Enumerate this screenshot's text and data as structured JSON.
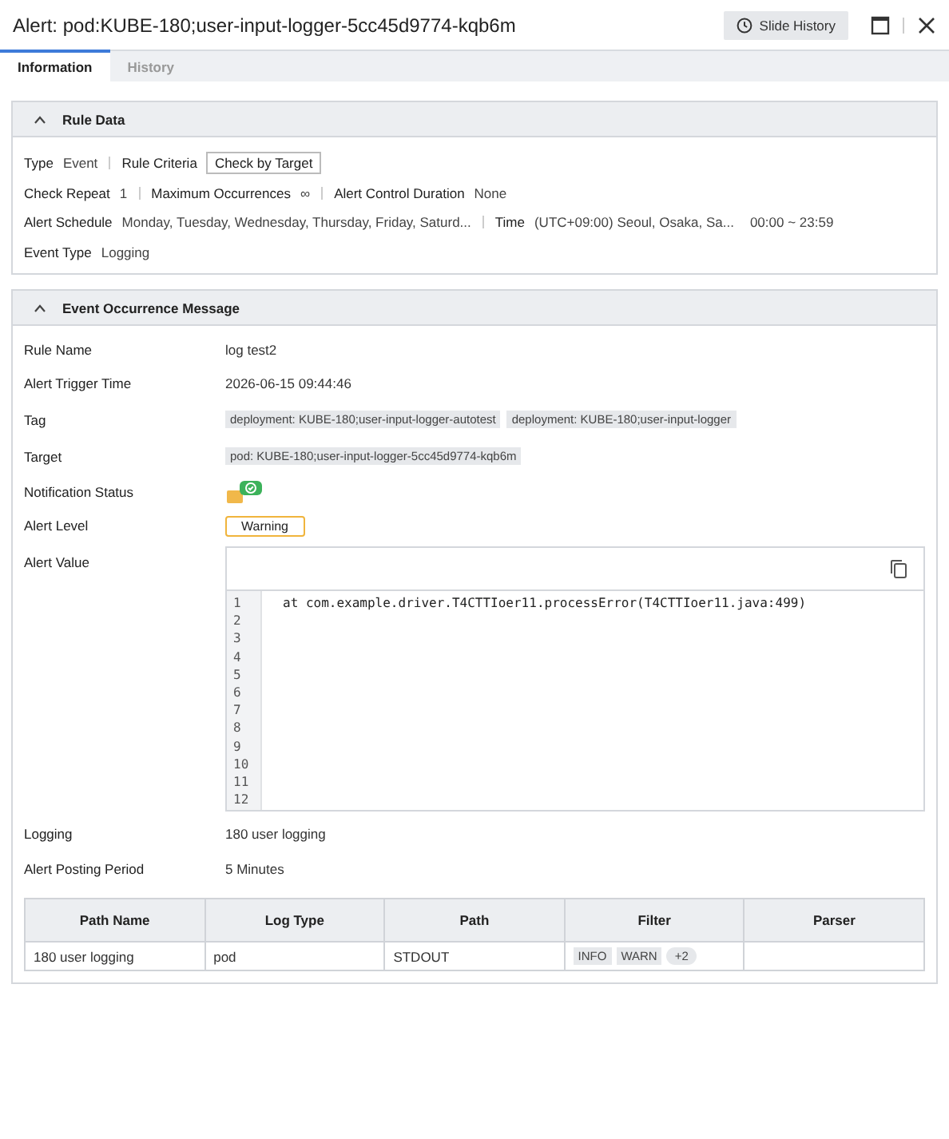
{
  "window": {
    "title": "Alert: pod:KUBE-180;user-input-logger-5cc45d9774-kqb6m",
    "history_button": "Slide History"
  },
  "tabs": [
    {
      "label": "Information",
      "selected": true
    },
    {
      "label": "History",
      "selected": false
    }
  ],
  "rule_data": {
    "title": "Rule Data",
    "expanded": true,
    "rows": [
      [
        {
          "label": "Type",
          "value": "Event",
          "kind": "text"
        },
        {
          "label": "Rule Criteria",
          "value": "Check by Target",
          "kind": "boxed"
        }
      ],
      [
        {
          "label": "Check Repeat",
          "value": "1",
          "kind": "text"
        },
        {
          "label": "Maximum Occurrences",
          "value": "∞",
          "kind": "text"
        },
        {
          "label": "Alert Control Duration",
          "value": "None",
          "kind": "text"
        }
      ],
      [
        {
          "label": "Alert Schedule",
          "value": "Monday, Tuesday, Wednesday, Thursday, Friday, Saturd...",
          "kind": "text"
        },
        {
          "label": "Time",
          "value": "(UTC+09:00) Seoul, Osaka, Sa...",
          "extra": "00:00 ~ 23:59",
          "kind": "text"
        }
      ],
      [
        {
          "label": "Event Type",
          "value": "Logging",
          "kind": "text"
        }
      ]
    ]
  },
  "event": {
    "title": "Event Occurrence Message",
    "expanded": true,
    "fields": [
      {
        "label": "Rule Name",
        "kind": "text",
        "value": "log test2"
      },
      {
        "label": "Alert Trigger Time",
        "kind": "text",
        "value": "2026-06-15 09:44:46"
      },
      {
        "label": "Tag",
        "kind": "tags",
        "tags": [
          "deployment: KUBE-180;user-input-logger-autotest",
          "deployment: KUBE-180;user-input-logger"
        ]
      },
      {
        "label": "Target",
        "kind": "tags",
        "tags": [
          "pod: KUBE-180;user-input-logger-5cc45d9774-kqb6m"
        ]
      },
      {
        "label": "Notification Status",
        "kind": "notification"
      },
      {
        "label": "Alert Level",
        "kind": "level",
        "value": "Warning",
        "color": "#f0b43c"
      },
      {
        "label": "Alert Value",
        "kind": "code",
        "line_numbers": [
          "1",
          "2",
          "3",
          "4",
          "5",
          "6",
          "7",
          "8",
          "9",
          "10",
          "11",
          "12"
        ],
        "code": "at com.example.driver.T4CTTIoer11.processError(T4CTTIoer11.java:499)"
      },
      {
        "label": "Logging",
        "kind": "text",
        "value": "180 user logging"
      },
      {
        "label": "Alert Posting Period",
        "kind": "text",
        "value": "5 Minutes"
      }
    ],
    "table": {
      "columns": [
        "Path Name",
        "Log Type",
        "Path",
        "Filter",
        "Parser"
      ],
      "rows": [
        {
          "path_name": "180 user logging",
          "log_type": "pod",
          "path": "STDOUT",
          "filters": [
            "INFO",
            "WARN"
          ],
          "more": "+2"
        }
      ]
    }
  }
}
